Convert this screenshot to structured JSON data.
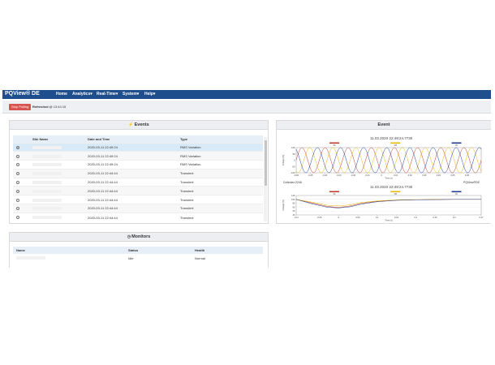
{
  "app": {
    "brand": "PQView® DE"
  },
  "nav": {
    "items": [
      "Home",
      "Analytics",
      "Real-Time",
      "System",
      "Help"
    ],
    "dropdown": [
      false,
      true,
      true,
      true,
      true
    ]
  },
  "toolbar": {
    "stop_label": "Stop Polling",
    "refreshed_label": "Refreshed @",
    "refreshed_time": "13:44:15"
  },
  "events": {
    "title": "Events",
    "icon": "lightning-icon",
    "columns": [
      "Site Name",
      "Date and Time",
      "Type"
    ],
    "rows": [
      {
        "selected": true,
        "datetime": "2020-03-11 22:49:24",
        "type": "RMS Variation"
      },
      {
        "selected": false,
        "datetime": "2020-03-11 22:49:24",
        "type": "RMS Variation"
      },
      {
        "selected": false,
        "datetime": "2020-03-11 22:49:24",
        "type": "RMS Variation"
      },
      {
        "selected": false,
        "datetime": "2020-03-11 22:44:44",
        "type": "Transient"
      },
      {
        "selected": false,
        "datetime": "2020-03-11 22:44:44",
        "type": "Transient"
      },
      {
        "selected": false,
        "datetime": "2020-03-11 22:44:44",
        "type": "Transient"
      },
      {
        "selected": false,
        "datetime": "2020-03-11 22:44:44",
        "type": "Transient"
      },
      {
        "selected": false,
        "datetime": "2020-03-11 22:44:44",
        "type": "Transient"
      },
      {
        "selected": false,
        "datetime": "2020-03-11 22:44:44",
        "type": "Transient"
      }
    ]
  },
  "monitors": {
    "title": "Monitors",
    "icon": "clock-icon",
    "columns": [
      "Name",
      "Status",
      "Health"
    ],
    "rows": [
      {
        "status": "Idle",
        "health": "Normal"
      }
    ]
  },
  "event_panel": {
    "title": "Event",
    "chart_top_title": "11.03.2020 22:49:24.7730",
    "chart_bottom_title": "11.03.2020 22:49:24.7730",
    "top_footer_left": "CntIndex:2246",
    "top_footer_right": "PQView®DE",
    "colors": {
      "a": "#c0392b",
      "b": "#e6b800",
      "c": "#1f3a93"
    }
  },
  "chart_data": [
    {
      "type": "line",
      "title": "11.03.2020 22:49:24.7730",
      "xlabel": "Time (s)",
      "ylabel": "Voltage (%)",
      "xlim": [
        -0.06,
        0.07
      ],
      "ylim": [
        -100,
        100
      ],
      "x_ticks": [
        "-0.06",
        "-0.05",
        "-0.04",
        "-0.03",
        "-0.02",
        "-0.01",
        "0",
        "0.01",
        "0.02",
        "0.03",
        "0.04",
        "0.05",
        "0.06"
      ],
      "y_ticks": [
        "-100",
        "-50",
        "0",
        "50",
        "100"
      ],
      "legend": [
        "VA",
        "VB",
        "VC"
      ],
      "series": [
        {
          "name": "VA",
          "waveform": "sine",
          "amplitude": 100,
          "cycles": 8,
          "phase_deg": 0,
          "color": "#c0392b"
        },
        {
          "name": "VB",
          "waveform": "sine",
          "amplitude": 100,
          "cycles": 8,
          "phase_deg": -120,
          "color": "#e6b800"
        },
        {
          "name": "VC",
          "waveform": "sine",
          "amplitude": 100,
          "cycles": 8,
          "phase_deg": 120,
          "color": "#1f3a93"
        }
      ]
    },
    {
      "type": "line",
      "title": "11.03.2020 22:49:24.7730",
      "xlabel": "Time (s)",
      "ylabel": "Voltage (%)",
      "xlim": [
        -0.11,
        0.37
      ],
      "ylim": [
        20,
        120
      ],
      "x_ticks": [
        "-0.11",
        "-0.05",
        "0",
        "0.05",
        "0.1",
        "0.15",
        "0.2",
        "0.25",
        "0.3",
        "0.37"
      ],
      "y_ticks": [
        "20",
        "40",
        "60",
        "80",
        "100",
        "120"
      ],
      "legend": [
        "VA",
        "VB",
        "VC"
      ],
      "series": [
        {
          "name": "VA",
          "color": "#c0392b",
          "x": [
            -0.11,
            -0.07,
            -0.03,
            0.0,
            0.03,
            0.06,
            0.1,
            0.15,
            0.2,
            0.25,
            0.3,
            0.37
          ],
          "y": [
            100,
            82,
            64,
            58,
            66,
            80,
            90,
            96,
            98,
            99,
            100,
            100
          ]
        },
        {
          "name": "VB",
          "color": "#e6b800",
          "x": [
            -0.11,
            -0.07,
            -0.03,
            0.0,
            0.03,
            0.06,
            0.1,
            0.15,
            0.2,
            0.25,
            0.3,
            0.37
          ],
          "y": [
            100,
            86,
            70,
            66,
            72,
            84,
            92,
            97,
            99,
            100,
            100,
            100
          ]
        },
        {
          "name": "VC",
          "color": "#1f3a93",
          "x": [
            -0.11,
            -0.07,
            -0.03,
            0.0,
            0.03,
            0.06,
            0.1,
            0.15,
            0.2,
            0.25,
            0.3,
            0.37
          ],
          "y": [
            100,
            78,
            60,
            56,
            62,
            76,
            88,
            95,
            98,
            99,
            100,
            100
          ]
        }
      ]
    }
  ]
}
